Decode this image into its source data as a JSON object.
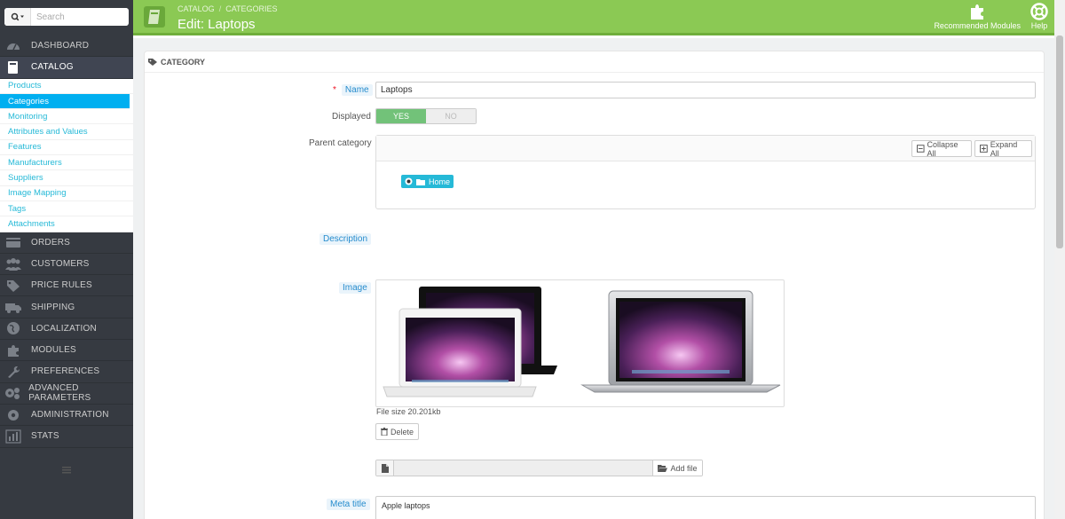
{
  "search": {
    "placeholder": "Search"
  },
  "nav": {
    "dashboard": "DASHBOARD",
    "catalog": "CATALOG",
    "orders": "ORDERS",
    "customers": "CUSTOMERS",
    "price_rules": "PRICE RULES",
    "shipping": "SHIPPING",
    "localization": "LOCALIZATION",
    "modules": "MODULES",
    "preferences": "PREFERENCES",
    "advanced_parameters": "ADVANCED PARAMETERS",
    "administration": "ADMINISTRATION",
    "stats": "STATS"
  },
  "submenu": {
    "products": "Products",
    "categories": "Categories",
    "monitoring": "Monitoring",
    "attributes": "Attributes and Values",
    "features": "Features",
    "manufacturers": "Manufacturers",
    "suppliers": "Suppliers",
    "image_mapping": "Image Mapping",
    "tags": "Tags",
    "attachments": "Attachments"
  },
  "header": {
    "breadcrumb": [
      "CATALOG",
      "/",
      "CATEGORIES"
    ],
    "title": "Edit: Laptops",
    "recommended_modules": "Recommended Modules",
    "help": "Help"
  },
  "panel": {
    "heading": "CATEGORY"
  },
  "form": {
    "name_label": "Name",
    "name_required": "*",
    "name_value": "Laptops",
    "displayed_label": "Displayed",
    "displayed_yes": "YES",
    "displayed_no": "NO",
    "displayed_value": true,
    "parent_label": "Parent category",
    "collapse_all": "Collapse All",
    "expand_all": "Expand All",
    "tree_home": "Home",
    "description_label": "Description",
    "image_label": "Image",
    "file_size": "File size 20.201kb",
    "delete": "Delete",
    "add_file": "Add file",
    "meta_title_label": "Meta title",
    "meta_title_value": "Apple laptops"
  },
  "colors": {
    "header_green": "#8bc954",
    "sidebar_dark": "#363a41",
    "link_blue": "#25b9d7",
    "active_sub": "#00aff0",
    "yes_green": "#72c279"
  }
}
